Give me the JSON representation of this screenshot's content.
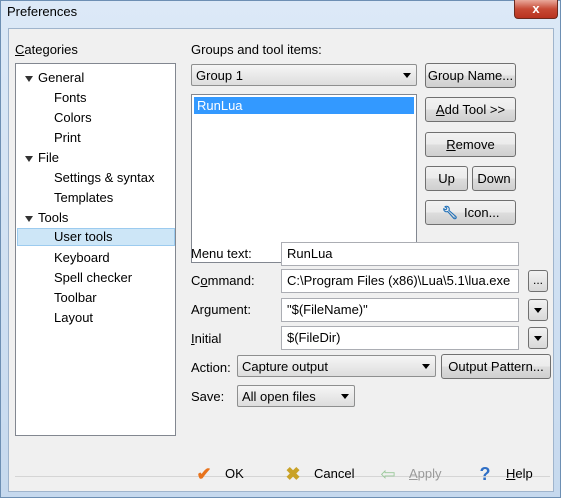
{
  "window": {
    "title": "Preferences",
    "close_glyph": "x"
  },
  "categories": {
    "label": "Categories",
    "items": [
      {
        "label": "General",
        "level": 0,
        "expanded": true
      },
      {
        "label": "Fonts",
        "level": 1
      },
      {
        "label": "Colors",
        "level": 1
      },
      {
        "label": "Print",
        "level": 1
      },
      {
        "label": "File",
        "level": 0,
        "expanded": true
      },
      {
        "label": "Settings & syntax",
        "level": 1
      },
      {
        "label": "Templates",
        "level": 1
      },
      {
        "label": "Tools",
        "level": 0,
        "expanded": true
      },
      {
        "label": "User tools",
        "level": 1,
        "selected": true
      },
      {
        "label": "Keyboard",
        "level": 1
      },
      {
        "label": "Spell checker",
        "level": 1
      },
      {
        "label": "Toolbar",
        "level": 1
      },
      {
        "label": "Layout",
        "level": 1
      }
    ]
  },
  "groups": {
    "label": "Groups and tool items:",
    "selected_group": "Group 1",
    "tool_items": [
      "RunLua"
    ],
    "selected_tool": "RunLua"
  },
  "buttons": {
    "group_name": "Group Name...",
    "add_tool": "Add Tool >>",
    "remove": "Remove",
    "up": "Up",
    "down": "Down",
    "icon": "Icon...",
    "browse": "...",
    "output_pattern": "Output Pattern..."
  },
  "fields": {
    "menu_text_label": "Menu text:",
    "menu_text_value": "RunLua",
    "command_label": "Command:",
    "command_value": "C:\\Program Files (x86)\\Lua\\5.1\\lua.exe",
    "argument_label": "Argument:",
    "argument_value": "\"$(FileName)\"",
    "initial_label": "Initial",
    "initial_value": "$(FileDir)",
    "action_label": "Action:",
    "action_value": "Capture output",
    "save_label": "Save:",
    "save_value": "All open files"
  },
  "footer": {
    "ok": "OK",
    "cancel": "Cancel",
    "apply": "Apply",
    "help": "Help",
    "ok_icon": "checkmark-icon",
    "cancel_icon": "x-icon",
    "apply_icon": "arrow-left-icon",
    "help_icon": "question-icon",
    "ok_color": "#e8731c",
    "cancel_color": "#c9a227",
    "apply_color": "#9bc99b",
    "help_color": "#2f6fc6"
  }
}
